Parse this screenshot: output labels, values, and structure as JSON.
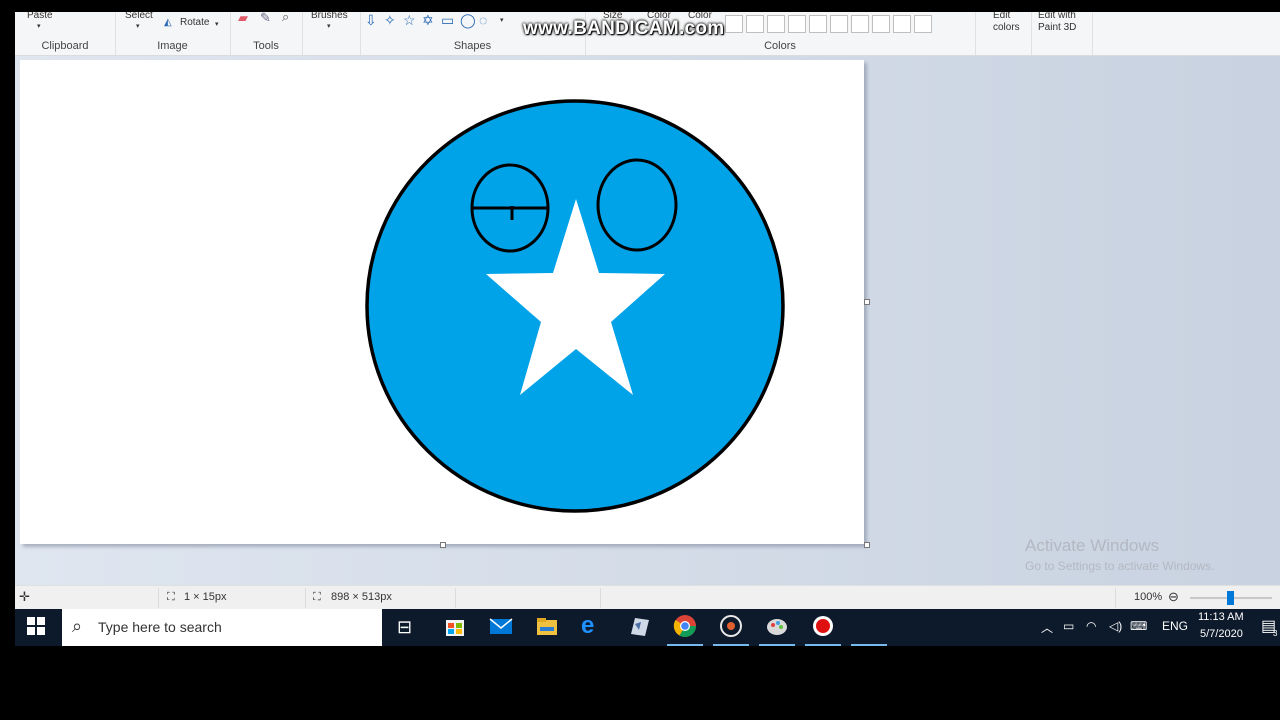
{
  "app": {
    "watermark": "www.BANDICAM.com"
  },
  "ribbon": {
    "paste_label": "Paste",
    "select_label": "Select",
    "rotate_label": "Rotate",
    "brushes_label": "Brushes",
    "size_label": "Size",
    "color1_label": "Color",
    "color2_label": "Color",
    "edit_colors_label": "Edit colors",
    "edit_paint3d_label": "Edit with Paint 3D",
    "groups": {
      "clipboard": "Clipboard",
      "image": "Image",
      "tools": "Tools",
      "shapes": "Shapes",
      "colors": "Colors"
    }
  },
  "drawing": {
    "fill_color": "#00a2e8",
    "outline_color": "#000000",
    "star_color": "#ffffff",
    "description_icons": [
      "circle-face",
      "star"
    ]
  },
  "watermark_windows": {
    "title": "Activate Windows",
    "subtitle": "Go to Settings to activate Windows."
  },
  "statusbar": {
    "selection_size": "1 × 15px",
    "image_size": "898 × 513px",
    "zoom": "100%",
    "zoom_level": 1.0
  },
  "taskbar": {
    "search_placeholder": "Type here to search",
    "language": "ENG",
    "time": "11:13 AM",
    "date": "5/7/2020",
    "notification_count": "3"
  }
}
